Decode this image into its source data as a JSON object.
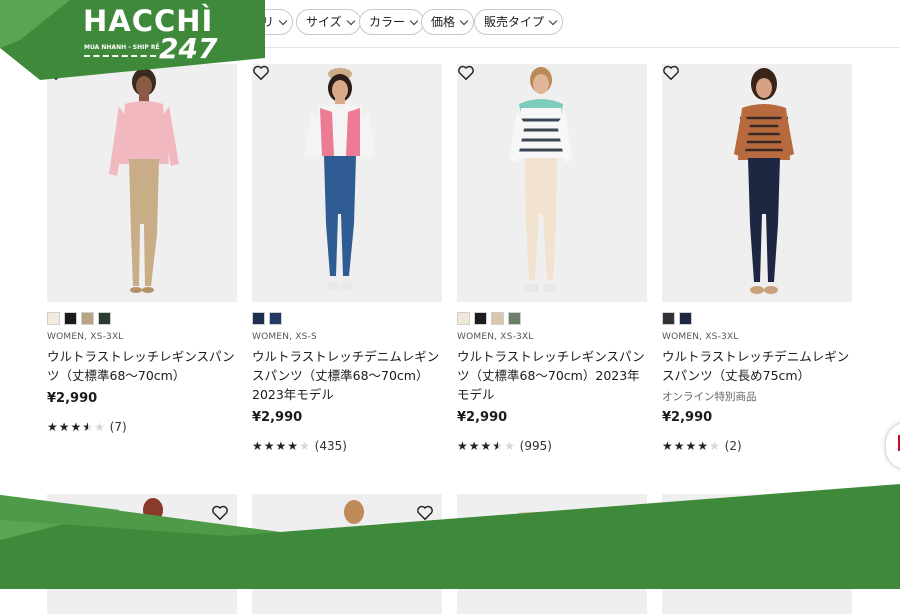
{
  "filters": [
    {
      "label": "リ"
    },
    {
      "label": "サイズ"
    },
    {
      "label": "カラー"
    },
    {
      "label": "価格"
    },
    {
      "label": "販売タイプ"
    }
  ],
  "logo": {
    "name": "HACCHÌ",
    "number": "247",
    "tagline": "MUA NHANH - SHIP RẺ",
    "brand_color": "#3f8a3a"
  },
  "products": [
    {
      "swatches": [
        "#f3ecdc",
        "#1c1c1c",
        "#b8a382",
        "#2b3d33"
      ],
      "meta": "WOMEN, XS-3XL",
      "name": "ウルトラストレッチレギンスパンツ（丈標準68〜70cm）",
      "note": "",
      "price": "¥2,990",
      "rating": 3.5,
      "reviews": "(7)"
    },
    {
      "swatches": [
        "#1f2f4f",
        "#233a66"
      ],
      "meta": "WOMEN, XS-S",
      "name": "ウルトラストレッチデニムレギンスパンツ（丈標準68〜70cm）2023年モデル",
      "note": "",
      "price": "¥2,990",
      "rating": 4,
      "reviews": "(435)"
    },
    {
      "swatches": [
        "#f1e8da",
        "#1c1c1c",
        "#d9c6ac",
        "#6b7e6a"
      ],
      "meta": "WOMEN, XS-3XL",
      "name": "ウルトラストレッチレギンスパンツ（丈標準68〜70cm）2023年モデル",
      "note": "",
      "price": "¥2,990",
      "rating": 3.5,
      "reviews": "(995)"
    },
    {
      "swatches": [
        "#2f3338",
        "#1e2744"
      ],
      "meta": "WOMEN, XS-3XL",
      "name": "ウルトラストレッチデニムレギンスパンツ（丈長め75cm）",
      "note": "オンライン特別商品",
      "price": "¥2,990",
      "rating": 4,
      "reviews": "(2)"
    }
  ],
  "colors": {
    "banner_green": "#3f8a3a",
    "banner_green_light": "#5aa452"
  }
}
